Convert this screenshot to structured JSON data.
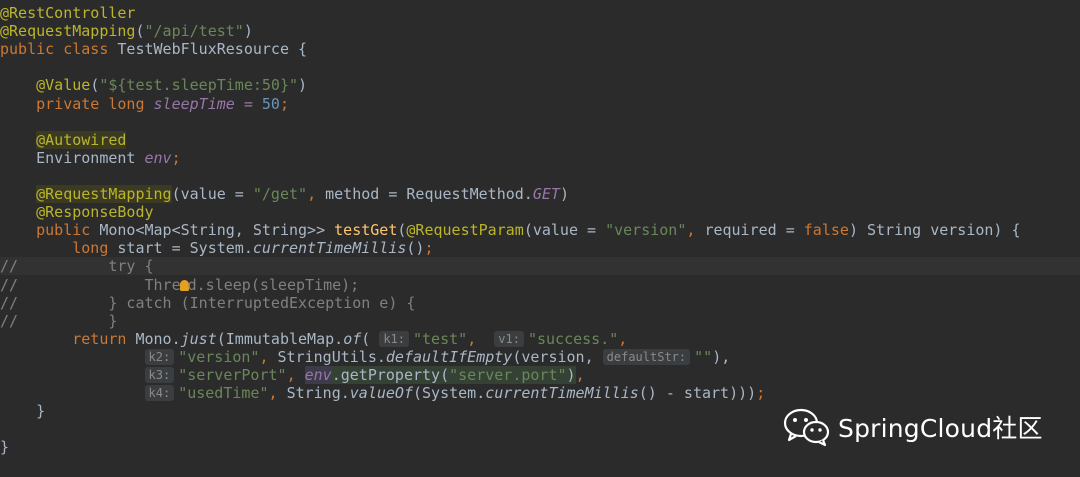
{
  "editor": {
    "lines": [
      {
        "segments": [
          {
            "t": "@RestController",
            "c": "ann"
          }
        ]
      },
      {
        "segments": [
          {
            "t": "@RequestMapping",
            "c": "ann"
          },
          {
            "t": "(",
            "c": ""
          },
          {
            "t": "\"/api/test\"",
            "c": "str"
          },
          {
            "t": ")",
            "c": ""
          }
        ]
      },
      {
        "segments": [
          {
            "t": "public class ",
            "c": "kw"
          },
          {
            "t": "TestWebFluxResource {",
            "c": ""
          }
        ]
      },
      {
        "segments": []
      },
      {
        "segments": [
          {
            "t": "    ",
            "c": ""
          },
          {
            "t": "@Value",
            "c": "ann"
          },
          {
            "t": "(",
            "c": ""
          },
          {
            "t": "\"${test.sleepTime:50}\"",
            "c": "str"
          },
          {
            "t": ")",
            "c": ""
          }
        ]
      },
      {
        "segments": [
          {
            "t": "    ",
            "c": ""
          },
          {
            "t": "private long ",
            "c": "kw"
          },
          {
            "t": "sleepTime = ",
            "c": "const"
          },
          {
            "t": "50",
            "c": "num"
          },
          {
            "t": ";",
            "c": "kw"
          }
        ]
      },
      {
        "segments": []
      },
      {
        "segments": [
          {
            "t": "    ",
            "c": ""
          },
          {
            "t": "@Autowired",
            "c": "ann hl-ann"
          }
        ]
      },
      {
        "segments": [
          {
            "t": "    Environment ",
            "c": ""
          },
          {
            "t": "env",
            "c": "const"
          },
          {
            "t": ";",
            "c": "kw"
          }
        ]
      },
      {
        "segments": []
      },
      {
        "segments": [
          {
            "t": "    ",
            "c": ""
          },
          {
            "t": "@RequestMapping",
            "c": "ann hl-ann"
          },
          {
            "t": "(value = ",
            "c": ""
          },
          {
            "t": "\"/get\"",
            "c": "str"
          },
          {
            "t": ", ",
            "c": "kw"
          },
          {
            "t": "method = RequestMethod.",
            "c": ""
          },
          {
            "t": "GET",
            "c": "const"
          },
          {
            "t": ")",
            "c": ""
          }
        ]
      },
      {
        "segments": [
          {
            "t": "    ",
            "c": ""
          },
          {
            "t": "@ResponseBody",
            "c": "ann"
          }
        ]
      },
      {
        "segments": [
          {
            "t": "    ",
            "c": ""
          },
          {
            "t": "public ",
            "c": "kw"
          },
          {
            "t": "Mono<Map<String, String>> ",
            "c": ""
          },
          {
            "t": "testGet",
            "c": "method"
          },
          {
            "t": "(",
            "c": ""
          },
          {
            "t": "@RequestParam",
            "c": "ann"
          },
          {
            "t": "(value = ",
            "c": ""
          },
          {
            "t": "\"version\"",
            "c": "str"
          },
          {
            "t": ", ",
            "c": "kw"
          },
          {
            "t": "required = ",
            "c": ""
          },
          {
            "t": "false",
            "c": "kw"
          },
          {
            "t": ") String version) {",
            "c": ""
          }
        ]
      },
      {
        "segments": [
          {
            "t": "        ",
            "c": ""
          },
          {
            "t": "long ",
            "c": "kw"
          },
          {
            "t": "start = System.",
            "c": ""
          },
          {
            "t": "currentTimeMillis",
            "c": "ital"
          },
          {
            "t": "()",
            "c": ""
          },
          {
            "t": ";",
            "c": "kw"
          }
        ]
      },
      {
        "row": "hl",
        "segments": [
          {
            "t": "//          try {",
            "c": "cmt"
          }
        ]
      },
      {
        "segments": [
          {
            "t": "//              Thre",
            "c": "cmt"
          },
          {
            "t": "",
            "c": "bulb"
          },
          {
            "t": "d.sleep(sleepTime);",
            "c": "cmt"
          }
        ]
      },
      {
        "segments": [
          {
            "t": "//          } catch (InterruptedException e) {",
            "c": "cmt"
          }
        ]
      },
      {
        "segments": [
          {
            "t": "//          }",
            "c": "cmt"
          }
        ]
      },
      {
        "segments": [
          {
            "t": "        ",
            "c": ""
          },
          {
            "t": "return ",
            "c": "kw"
          },
          {
            "t": "Mono.",
            "c": ""
          },
          {
            "t": "just",
            "c": "ital"
          },
          {
            "t": "(ImmutableMap.",
            "c": ""
          },
          {
            "t": "of",
            "c": "ital"
          },
          {
            "t": "( ",
            "c": ""
          },
          {
            "t": "k1:",
            "c": "hint"
          },
          {
            "t": "\"test\"",
            "c": "str"
          },
          {
            "t": ",  ",
            "c": "kw"
          },
          {
            "t": "v1:",
            "c": "hint"
          },
          {
            "t": "\"success.\"",
            "c": "str"
          },
          {
            "t": ",",
            "c": "kw"
          }
        ]
      },
      {
        "segments": [
          {
            "t": "                ",
            "c": ""
          },
          {
            "t": "k2:",
            "c": "hint"
          },
          {
            "t": "\"version\"",
            "c": "str"
          },
          {
            "t": ", ",
            "c": "kw"
          },
          {
            "t": "StringUtils.",
            "c": ""
          },
          {
            "t": "defaultIfEmpty",
            "c": "ital"
          },
          {
            "t": "(version, ",
            "c": ""
          },
          {
            "t": "defaultStr:",
            "c": "hint"
          },
          {
            "t": "\"\"",
            "c": "str"
          },
          {
            "t": "),",
            "c": ""
          }
        ]
      },
      {
        "segments": [
          {
            "t": "                ",
            "c": ""
          },
          {
            "t": "k3:",
            "c": "hint"
          },
          {
            "t": "\"serverPort\"",
            "c": "str"
          },
          {
            "t": ", ",
            "c": "kw"
          },
          {
            "t": "env",
            "c": "const hl-ref"
          },
          {
            "t": ".getProperty(",
            "c": "hl-usage"
          },
          {
            "t": "\"server.port\"",
            "c": "str hl-usage"
          },
          {
            "t": ")",
            "c": "hl-usage"
          },
          {
            "t": ",",
            "c": "kw"
          }
        ]
      },
      {
        "segments": [
          {
            "t": "                ",
            "c": ""
          },
          {
            "t": "k4:",
            "c": "hint"
          },
          {
            "t": "\"usedTime\"",
            "c": "str"
          },
          {
            "t": ", ",
            "c": "kw"
          },
          {
            "t": "String.",
            "c": ""
          },
          {
            "t": "valueOf",
            "c": "ital"
          },
          {
            "t": "(System.",
            "c": ""
          },
          {
            "t": "currentTimeMillis",
            "c": "ital"
          },
          {
            "t": "() - start)))",
            "c": ""
          },
          {
            "t": ";",
            "c": "kw"
          }
        ]
      },
      {
        "segments": [
          {
            "t": "    }",
            "c": ""
          }
        ]
      },
      {
        "segments": []
      },
      {
        "segments": [
          {
            "t": "}",
            "c": ""
          }
        ]
      }
    ]
  },
  "watermark": {
    "icon": "wechat-icon",
    "text": "SpringCloud社区"
  }
}
